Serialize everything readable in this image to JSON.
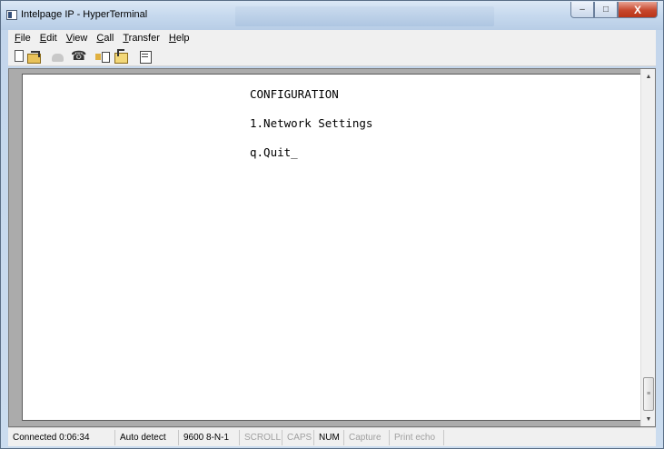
{
  "window": {
    "title": "Intelpage IP - HyperTerminal",
    "caption_buttons": {
      "minimize": "–",
      "maximize": "□",
      "close": "X"
    }
  },
  "menu": {
    "items": [
      {
        "underline": "F",
        "rest": "ile"
      },
      {
        "underline": "E",
        "rest": "dit"
      },
      {
        "underline": "V",
        "rest": "iew"
      },
      {
        "underline": "C",
        "rest": "all"
      },
      {
        "underline": "T",
        "rest": "ransfer"
      },
      {
        "underline": "H",
        "rest": "elp"
      }
    ]
  },
  "toolbar": {
    "icons": [
      "new-icon",
      "open-icon",
      "call-icon",
      "disconnect-icon",
      "send-icon",
      "receive-icon",
      "properties-icon"
    ]
  },
  "terminal": {
    "lines": [
      "CONFIGURATION",
      "1.Network Settings",
      "q.Quit_"
    ]
  },
  "scrollbar": {
    "up": "▲",
    "down": "▼",
    "grip": "≡"
  },
  "statusbar": {
    "connected": "Connected 0:06:34",
    "detect": "Auto detect",
    "settings": "9600 8-N-1",
    "scroll": "SCROLL",
    "caps": "CAPS",
    "num": "NUM",
    "capture": "Capture",
    "print_echo": "Print echo"
  }
}
